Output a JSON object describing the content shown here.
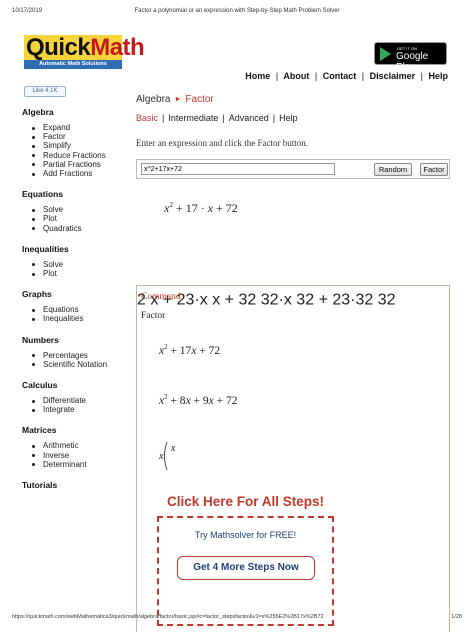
{
  "print_header": {
    "date": "10/17/2019",
    "title": "Factor a polynomial or an expression with Step-by-Step Math Problem Solver"
  },
  "logo": {
    "brand_quick": "Quick",
    "brand_math": "Math",
    "tagline": "Automatic Math Solutions"
  },
  "google_play": {
    "small": "GET IT ON",
    "big": "Google Play"
  },
  "topnav": {
    "home": "Home",
    "about": "About",
    "contact": "Contact",
    "disclaimer": "Disclaimer",
    "help": "Help",
    "sep": "|"
  },
  "like_button": "Like 4.1K",
  "sidebar": {
    "algebra": {
      "title": "Algebra",
      "items": [
        "Expand",
        "Factor",
        "Simplify",
        "Reduce Fractions",
        "Partial Fractions",
        "Add Fractions"
      ]
    },
    "equations": {
      "title": "Equations",
      "items": [
        "Solve",
        "Plot",
        "Quadratics"
      ]
    },
    "inequalities": {
      "title": "Inequalities",
      "items": [
        "Solve",
        "Plot"
      ]
    },
    "graphs": {
      "title": "Graphs",
      "items": [
        "Equations",
        "Inequalities"
      ]
    },
    "numbers": {
      "title": "Numbers",
      "items": [
        "Percentages",
        "Scientific Notation"
      ]
    },
    "calculus": {
      "title": "Calculus",
      "items": [
        "Differentiate",
        "Integrate"
      ]
    },
    "matrices": {
      "title": "Matrices",
      "items": [
        "Arithmetic",
        "Inverse",
        "Determinant"
      ]
    },
    "tutorials": {
      "title": "Tutorials"
    }
  },
  "main": {
    "breadcrumb_parent": "Algebra",
    "breadcrumb_current": "Factor",
    "modes": {
      "basic": "Basic",
      "intermediate": "Intermediate",
      "advanced": "Advanced",
      "help": "Help"
    },
    "instructions": "Enter an expression and click the Factor button.",
    "input_value": "x^2+17x+72",
    "random_button": "Random",
    "factor_button": "Factor"
  },
  "result": {
    "command_label": "Command",
    "function_name": "Factor",
    "all_steps": "Click Here For All Steps!",
    "try_text": "Try Mathsolver for FREE!",
    "get_steps_button": "Get 4 More Steps Now"
  },
  "footer": {
    "url": "https://quickmath.com/webMathematica3/quickmath/algebra/factor/basic.jsp#c=factor_stepsfactor&v1=x%255E2%2B17x%2B72",
    "page": "1/28"
  }
}
